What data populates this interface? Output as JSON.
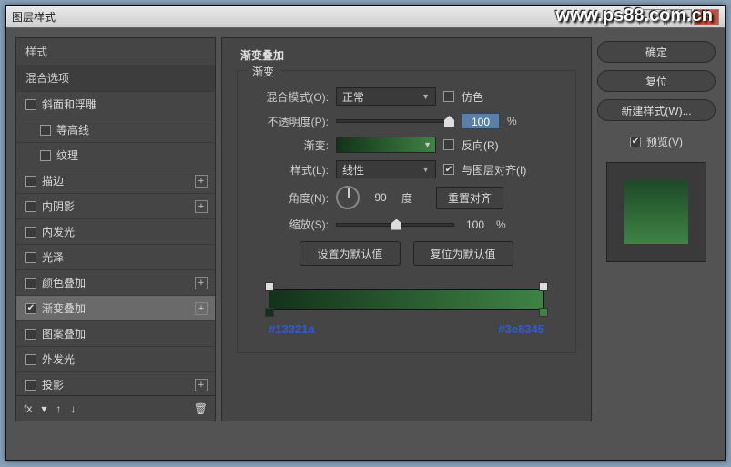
{
  "window": {
    "title": "图层样式"
  },
  "watermark": "www.ps88.com.cn",
  "left": {
    "styles_header": "样式",
    "blend_header": "混合选项",
    "items": [
      {
        "label": "斜面和浮雕",
        "checked": false,
        "plus": false,
        "indent": false
      },
      {
        "label": "等高线",
        "checked": false,
        "plus": false,
        "indent": true
      },
      {
        "label": "纹理",
        "checked": false,
        "plus": false,
        "indent": true
      },
      {
        "label": "描边",
        "checked": false,
        "plus": true,
        "indent": false
      },
      {
        "label": "内阴影",
        "checked": false,
        "plus": true,
        "indent": false
      },
      {
        "label": "内发光",
        "checked": false,
        "plus": false,
        "indent": false
      },
      {
        "label": "光泽",
        "checked": false,
        "plus": false,
        "indent": false
      },
      {
        "label": "颜色叠加",
        "checked": false,
        "plus": true,
        "indent": false
      },
      {
        "label": "渐变叠加",
        "checked": true,
        "plus": true,
        "indent": false,
        "active": true
      },
      {
        "label": "图案叠加",
        "checked": false,
        "plus": false,
        "indent": false
      },
      {
        "label": "外发光",
        "checked": false,
        "plus": false,
        "indent": false
      },
      {
        "label": "投影",
        "checked": false,
        "plus": true,
        "indent": false
      }
    ],
    "footer_fx": "fx"
  },
  "mid": {
    "section_title": "渐变叠加",
    "fieldset_title": "渐变",
    "blend_mode_label": "混合模式(O):",
    "blend_mode_value": "正常",
    "dither_label": "仿色",
    "opacity_label": "不透明度(P):",
    "opacity_value": "100",
    "percent": "%",
    "gradient_label": "渐变:",
    "reverse_label": "反向(R)",
    "style_label": "样式(L):",
    "style_value": "线性",
    "align_label": "与图层对齐(I)",
    "align_checked": true,
    "angle_label": "角度(N):",
    "angle_value": "90",
    "degree": "度",
    "reset_align": "重置对齐",
    "scale_label": "缩放(S):",
    "scale_value": "100",
    "set_default": "设置为默认值",
    "reset_default": "复位为默认值",
    "hex_left": "#13321a",
    "hex_right": "#3e8345"
  },
  "right": {
    "ok": "确定",
    "cancel": "复位",
    "new_style": "新建样式(W)...",
    "preview_label": "预览(V)"
  }
}
